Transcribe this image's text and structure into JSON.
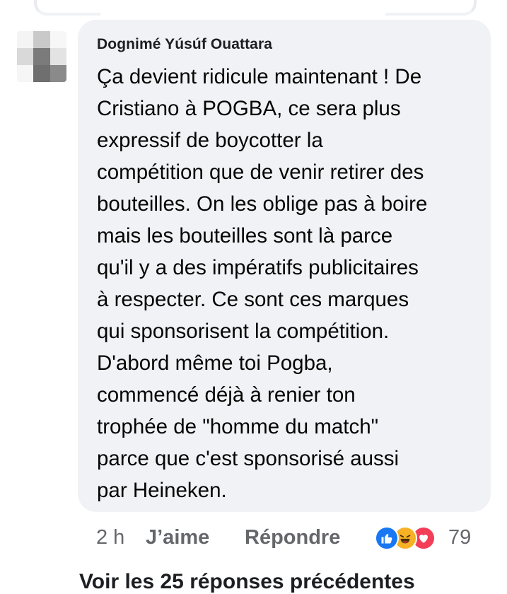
{
  "comment": {
    "author": "Dognimé Yúsúf Ouattara",
    "text_lines": [
      "Ça devient ridicule maintenant ! De",
      "Cristiano à POGBA, ce sera plus",
      "expressif de boycotter la",
      "compétition que de venir retirer des",
      "bouteilles. On les oblige pas à boire",
      "mais les bouteilles sont là parce",
      "qu'il y a des impératifs publicitaires",
      "à respecter. Ce sont ces marques",
      "qui sponsorisent la compétition.",
      "D'abord même toi Pogba,",
      "commencé déjà à renier ton",
      "trophée de \"homme du match\"",
      "parce que c'est sponsorisé aussi",
      "par Heineken."
    ]
  },
  "actions": {
    "time": "2 h",
    "like_label": "J’aime",
    "reply_label": "Répondre"
  },
  "reactions": {
    "types": [
      "like-icon",
      "haha-icon",
      "love-icon"
    ],
    "count": "79"
  },
  "more_replies_label": "Voir les 25 réponses précédentes",
  "colors": {
    "bubble": "#f0f2f5",
    "meta_text": "#65676b",
    "like": "#1877f2",
    "haha": "#f7b125",
    "love": "#f33e58"
  }
}
